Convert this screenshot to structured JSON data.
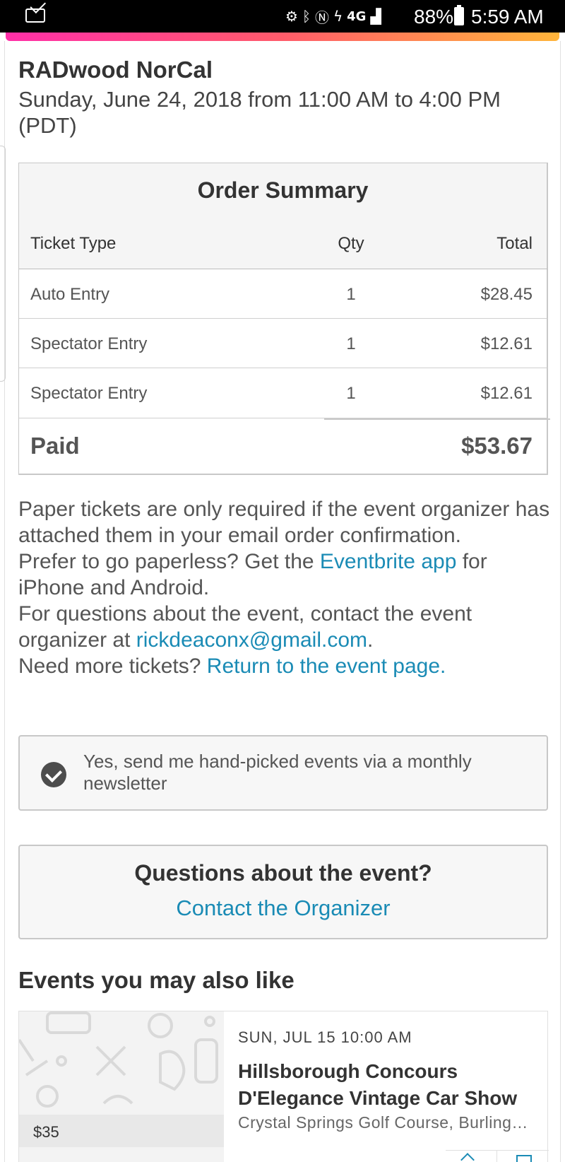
{
  "status_bar": {
    "battery": "88%",
    "time": "5:59 AM",
    "network": "4G"
  },
  "event": {
    "title": "RADwood NorCal",
    "date": "Sunday, June 24, 2018 from 11:00 AM to 4:00 PM (PDT)"
  },
  "order": {
    "title": "Order Summary",
    "headers": {
      "type": "Ticket Type",
      "qty": "Qty",
      "total": "Total"
    },
    "rows": [
      {
        "type": "Auto Entry",
        "qty": "1",
        "total": "$28.45"
      },
      {
        "type": "Spectator Entry",
        "qty": "1",
        "total": "$12.61"
      },
      {
        "type": "Spectator Entry",
        "qty": "1",
        "total": "$12.61"
      }
    ],
    "paid_label": "Paid",
    "paid_amount": "$53.67"
  },
  "info": {
    "p1": "Paper tickets are only required if the event organizer has attached them in your email order confirmation.",
    "p2_pre": "Prefer to go paperless? Get the ",
    "p2_link": "Eventbrite app",
    "p2_post": " for iPhone and Android.",
    "p3_pre": "For questions about the event, contact the event organizer at ",
    "p3_link": "rickdeaconx@gmail.com",
    "p3_post": ".",
    "p4_pre": "Need more tickets? ",
    "p4_link": "Return to the event page."
  },
  "newsletter": {
    "label": "Yes, send me hand-picked events via a monthly newsletter",
    "checked": true
  },
  "questions": {
    "title": "Questions about the event?",
    "link": "Contact the Organizer"
  },
  "suggested": {
    "heading": "Events you may also like",
    "cards": [
      {
        "date": "SUN, JUL 15 10:00 AM",
        "title": "Hillsborough Concours D'Elegance Vintage Car Show",
        "venue": "Crystal Springs Golf Course, Burlingame, CA",
        "price": "$35"
      }
    ]
  },
  "colors": {
    "link": "#1a8bb5",
    "gradient_start": "#ff2fa8",
    "gradient_end": "#ffb53a"
  }
}
